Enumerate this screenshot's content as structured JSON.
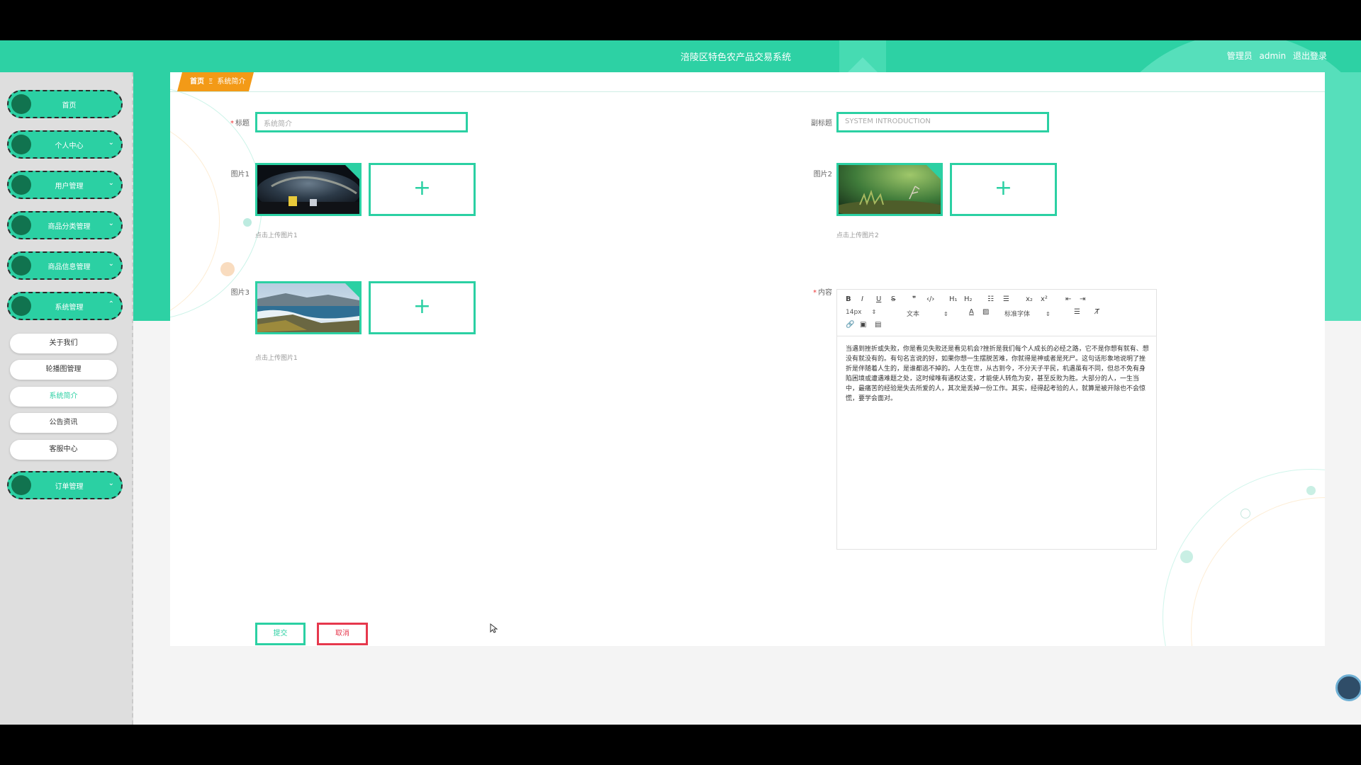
{
  "header": {
    "title": "涪陵区特色农产品交易系统",
    "role": "管理员",
    "username": "admin",
    "logout": "退出登录"
  },
  "sidebar": {
    "items": [
      {
        "label": "首页"
      },
      {
        "label": "个人中心"
      },
      {
        "label": "用户管理"
      },
      {
        "label": "商品分类管理"
      },
      {
        "label": "商品信息管理"
      },
      {
        "label": "系统管理"
      },
      {
        "label": "订单管理"
      }
    ],
    "sub_items": [
      {
        "label": "关于我们"
      },
      {
        "label": "轮播图管理"
      },
      {
        "label": "系统简介"
      },
      {
        "label": "公告资讯"
      },
      {
        "label": "客服中心"
      }
    ],
    "active_sub": "系统简介"
  },
  "breadcrumb": {
    "home": "首页",
    "separator": "Ξ",
    "current": "系统简介"
  },
  "form": {
    "title_label": "标题",
    "title_value": "系统简介",
    "subtitle_label": "副标题",
    "subtitle_value": "SYSTEM INTRODUCTION",
    "pic1_label": "图片1",
    "pic1_hint": "点击上传图片1",
    "pic2_label": "图片2",
    "pic2_hint": "点击上传图片2",
    "pic3_label": "图片3",
    "pic3_hint": "点击上传图片1",
    "content_label": "内容",
    "plus": "+",
    "submit": "提交",
    "cancel": "取消"
  },
  "editor": {
    "bold": "B",
    "italic": "I",
    "underline": "U",
    "strike": "S",
    "quote": "❞",
    "code": "‹/›",
    "h1": "H₁",
    "h2": "H₂",
    "ordered_list": "☷",
    "bullet_list": "☰",
    "subscript": "x₂",
    "superscript": "x²",
    "outdent": "⇤",
    "indent": "⇥",
    "size": "14px",
    "format": "文本",
    "color": "A",
    "background": "▨",
    "font": "标准字体",
    "align": "☰",
    "clean": "T̸",
    "link": "🔗",
    "image": "▣",
    "video": "▤",
    "content": "当遇到挫折或失败，你是看见失败还是看见机会?挫折是我们每个人成长的必经之路，它不是你想有就有、想没有就没有的。有句名言说的好，如果你想一生摆脱苦难，你就得是神或者是死尸。这句话形象地说明了挫折是伴随着人生的，是谁都逃不掉的。人生在世，从古到今，不分天子平民，机遇虽有不同，但总不免有身陷困境或遭遇难题之处，这时候唯有通权达变，才能使人转危为安，甚至反败为胜。大部分的人，一生当中，最痛苦的经验是失去所爱的人，其次是丢掉一份工作。其实，经得起考验的人，就算是被开除也不会惊慌，要学会面对。"
  }
}
